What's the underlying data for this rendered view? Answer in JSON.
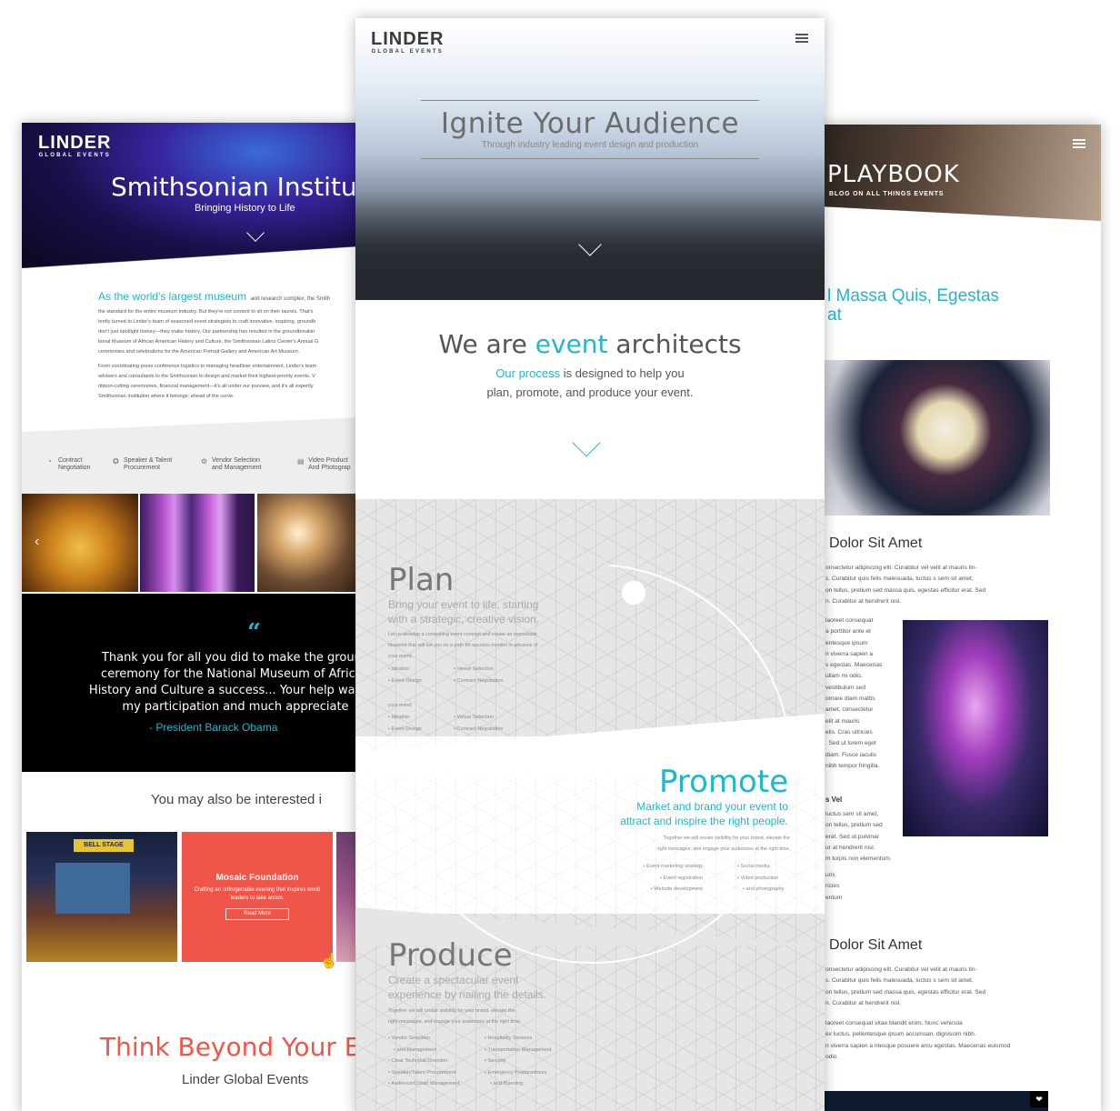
{
  "left": {
    "logo": {
      "name": "LINDER",
      "tag": "GLOBAL EVENTS"
    },
    "hero_title": "Smithsonian Institu",
    "hero_subtitle": "Bringing History to Life",
    "intro_lead": "As the world's largest museum",
    "intro_lead_rest": "and research complex, the Smith",
    "intro_lines": [
      "the standard for the entire museum industry. But they're not content to sit on their laurels. That's",
      "tently turned to Linder's team of seasoned event strategists to craft innovative, inspiring, groundb",
      "don't just spotlight history—they make history. Our partnership has resulted in the groundbreakin",
      "tional Museum of African American History and Culture, the Smithsonian Latino Center's Annual G",
      "ceremonies and celebrations for the American Portrait Gallery and American Art Museum."
    ],
    "intro_lines2": [
      "From coordinating press conference logistics to managing headliner entertainment, Linder's team",
      "advisers and consultants to the Smithsonian to design and market their highest-priority events. V",
      "ribbon-cutting ceremonies, financial management—it's all under our purview, and it's all expertly",
      "Smithsonian Institution where it belongs: ahead of the curve."
    ],
    "services": [
      {
        "label1": "Contract",
        "label2": "Negotiation",
        "icon": "contract-icon"
      },
      {
        "label1": "Speaker & Talent",
        "label2": "Procurement",
        "icon": "talent-icon"
      },
      {
        "label1": "Vendor Selection",
        "label2": "and Management",
        "icon": "vendor-icon"
      },
      {
        "label1": "Video Product",
        "label2": "And Photograp",
        "icon": "video-icon"
      }
    ],
    "quote_text": "Thank you for all you did to make the groundbreaking ceremony for the National Museum of African American History and Culture a success... Your help was instrumental to my participation and much appreciated.",
    "quote_lines": [
      "Thank you for all you did to make the ground",
      "ceremony for the National Museum of African",
      "History and Culture a success... Your help was ins",
      "my participation and much appreciate"
    ],
    "quote_author": "- President Barack Obama",
    "interested": "You may also be interested i",
    "card_title": "Mosaic Foundation",
    "card_desc": "Crafting an unforgettable evening that inspires world leaders to take action.",
    "card_button": "Read More",
    "card1_sign": "BELL STAGE",
    "think": "Think Beyond Your E",
    "think_sub": "Linder Global Events"
  },
  "center": {
    "logo": {
      "name": "LINDER",
      "tag": "GLOBAL EVENTS"
    },
    "hero_title": "Ignite Your Audience",
    "hero_subtitle": "Through industry leading event design and production",
    "we_are_1": "We are ",
    "we_are_accent": "event",
    "we_are_2": " architects",
    "process_accent": "Our process",
    "process_rest": " is designed to help you",
    "process_line2": "plan, promote, and produce your event.",
    "plan": {
      "title": "Plan",
      "subtitle_1": "Bring your event to life, starting",
      "subtitle_2": "with a strategic, creative vision.",
      "para": [
        "Let us develop a compelling event concept and create an executable",
        "blueprint that will set you on a path for success months in advance of",
        "your event."
      ],
      "list_a": [
        "Ideation",
        "Event Design"
      ],
      "list_b": [
        "Venue Selection",
        "Contract Negotiation"
      ],
      "para2": "your event.",
      "list_c": [
        "Ideation",
        "Event Design"
      ],
      "list_d": [
        "Venue Selection",
        "Contract Negotiation"
      ]
    },
    "promote": {
      "title": "Promote",
      "subtitle_1": "Market and brand your event to",
      "subtitle_2": "attract and inspire the right people.",
      "para": [
        "Together we will create visibility for your brand, elevate the",
        "right messages, and engage your audiences at the right time."
      ],
      "list_a": [
        "Event marketing strategy",
        "Event registration",
        "Website development"
      ],
      "list_b": [
        "Social media",
        "Video production",
        "and photography"
      ]
    },
    "produce": {
      "title": "Produce",
      "subtitle_1": "Create a spectacular event",
      "subtitle_2": "experience by nailing the details.",
      "para": [
        "Together we will create visibility for your brand, elevate the",
        "right messages, and engage your audiences at the right time."
      ],
      "list_a": [
        "Vendor Selection",
        "and Management",
        "Clear Technical Direction",
        "Speaker/Talent Procurement",
        "Audience/Crowd Management"
      ],
      "list_b": [
        "Hospitality Services",
        "Transportation Management",
        "Security",
        "Emergency Preparedness",
        "and Planning"
      ]
    }
  },
  "right": {
    "hero_title": "PLAYBOOK",
    "hero_subtitle": "BLOG ON ALL THINGS EVENTS",
    "post_title_1": "l Massa Quis, Egestas",
    "post_title_2": "at",
    "heading_1": "Dolor Sit Amet",
    "para_1": [
      "onsectetur adipiscing elit. Curabitur vel velit at mauris tin-",
      "s. Curabitur quis felis malesuada, luctus s sem sit amet,",
      "on tellus, pretium sed massa quis, egestas efficitur erat. Sed",
      "n. Curabitur at hendrerit nisl."
    ],
    "para_2": [
      "laoreet consequat",
      "a porttitor ante et",
      "entesque ipsum",
      "n viverra sapien a",
      "s egestas. Maecenas",
      "ullam mi odio,",
      "vestibulum sed",
      "ornare diam mattis",
      "amet, consectetur",
      "elit at mauris",
      "elis. Cras ultricies",
      ". Sed ut lorem eget",
      "diam. Fusce iaculis",
      "nibh tempor fringilla."
    ],
    "subhead": "s Vel",
    "para_3": [
      "luctus sem sit amet,",
      "on tellus, pretium sed",
      "erat. Sed ut pulvinar",
      "ur at hendrerit nisl.",
      "m turpis non elementum."
    ],
    "para_4": [
      "uris",
      "",
      "ricies",
      "entum"
    ],
    "heading_2": "Dolor Sit Amet",
    "para_5": [
      "onsectetur adipiscing elit. Curabitur vel velit at mauris tin-",
      "s. Curabitur quis felis malesuada, luctus s sem sit amet,",
      "on tellus, pretium sed massa quis, egestas efficitur erat. Sed",
      "n. Curabitur at hendrerit nisl."
    ],
    "para_6": [
      "laoreet consequat vitae blandit enim. Nunc vehicula",
      "ex luctus, pellentesque ipsum accumsan, dignissim nibh.",
      "entesque ipsum",
      "s egestas. Maecenas euismod",
      "n viverra sapien a",
      "odio."
    ],
    "para_6b": [
      "laoreet consequat vitae blandit enim. Nunc vehicula",
      "ex luctus, pellentesque ipsum accumsan, dignissim nibh.",
      "n viverra sapien a ntesque posuere arcu egestas. Maecenas euismod",
      "odio."
    ]
  }
}
